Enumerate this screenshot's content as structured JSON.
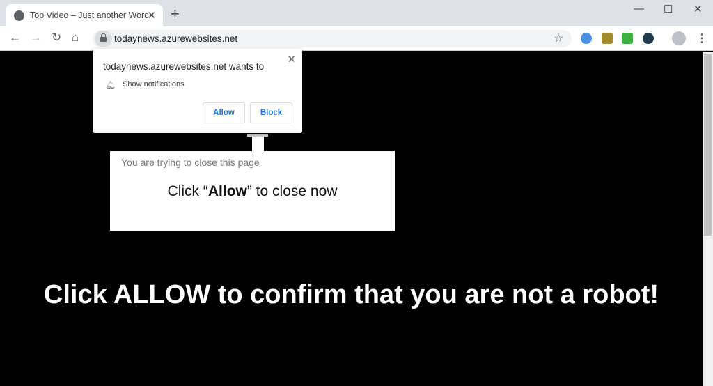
{
  "browser": {
    "tab_title": "Top Video – Just another WordPress site",
    "url": "todaynews.azurewebsites.net"
  },
  "popup": {
    "heading": "todaynews.azurewebsites.net wants to",
    "permission": "Show notifications",
    "allow": "Allow",
    "block": "Block"
  },
  "page": {
    "subtitle": "You are trying to close this page",
    "line_pre": "Click “",
    "line_bold": "Allow",
    "line_post": "” to close now",
    "headline": "Click ALLOW to confirm that you are not a robot!"
  },
  "colors": {
    "accent": "#1a73e8",
    "background": "#000000"
  }
}
